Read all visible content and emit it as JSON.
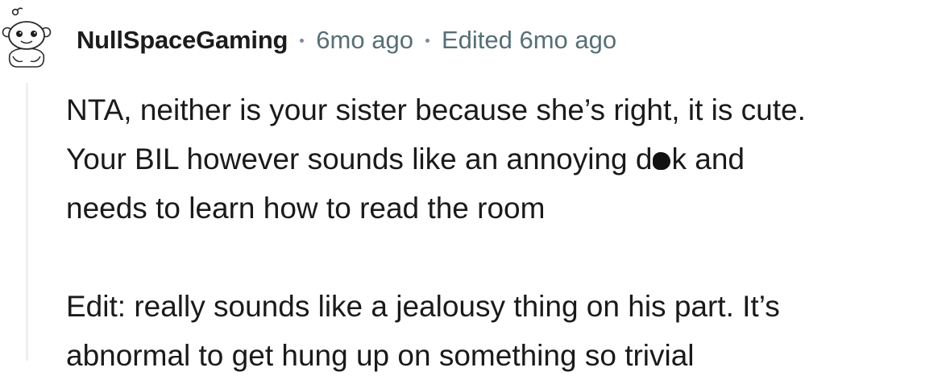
{
  "comment": {
    "author": "NullSpaceGaming",
    "posted": "6mo ago",
    "edited": "Edited 6mo ago",
    "paragraphs": [
      {
        "line1": "NTA, neither is your sister because she’s right, it is cute.",
        "line2_before": "Your BIL however sounds like an annoying d",
        "line2_after": "k and",
        "line3": "needs to learn how to read the room"
      },
      {
        "line1": "Edit: really sounds like a jealousy thing on his part. It’s",
        "line2": "abnormal to get hung up on something so trivial"
      }
    ]
  },
  "colors": {
    "text": "#1a1a1b",
    "meta": "#576f76",
    "thread_line": "#edeff1"
  },
  "icons": {
    "avatar": "reddit-snoo-avatar-icon",
    "censor": "censor-blot-icon"
  }
}
